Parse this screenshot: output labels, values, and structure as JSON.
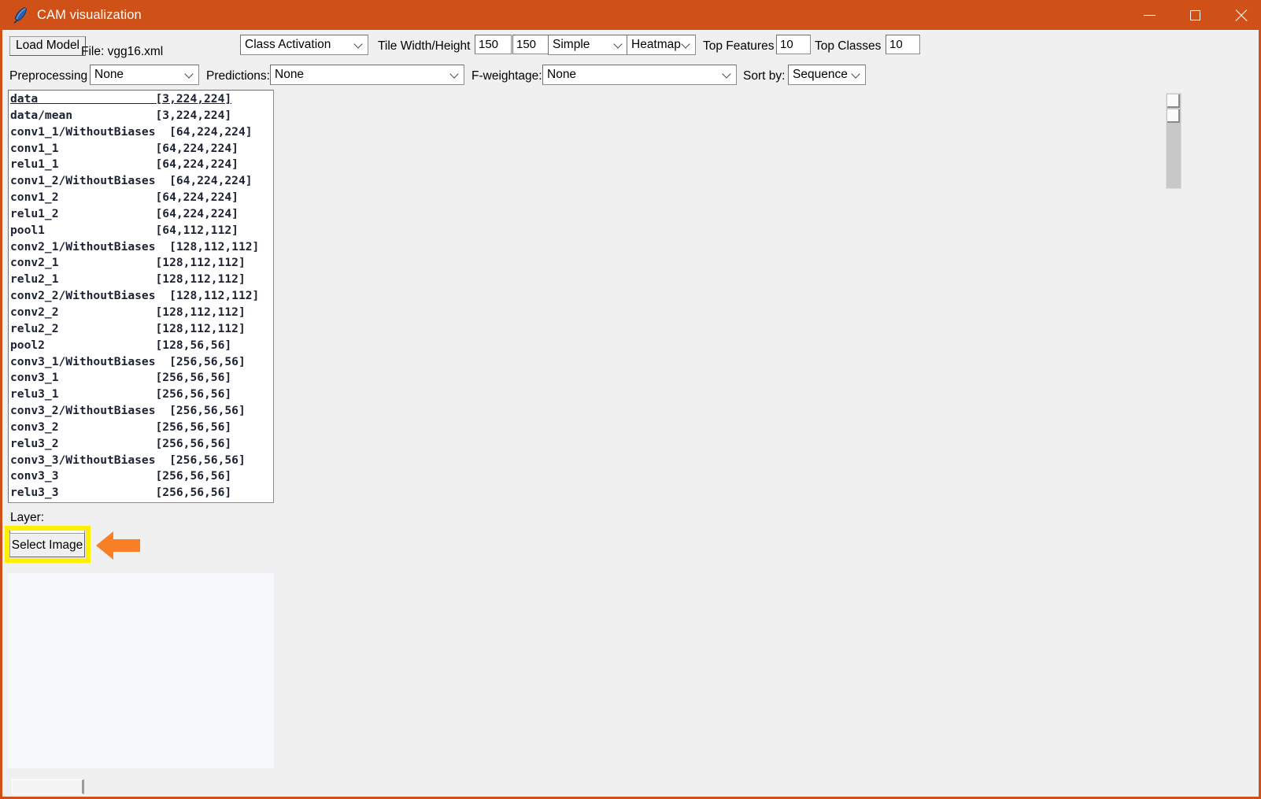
{
  "window": {
    "title": "CAM visualization",
    "icon": "feather-icon",
    "accent_color": "#cf5117",
    "controls": {
      "minimize": "minimize-icon",
      "maximize": "maximize-icon",
      "close": "close-icon"
    }
  },
  "toolbar": {
    "load_model_label": "Load Model",
    "file_label": "File: vgg16.xml",
    "mode_combo": "Class Activation",
    "tile_label": "Tile Width/Height",
    "tile_width": "150",
    "tile_height": "150",
    "simple_combo": "Simple",
    "heatmap_combo": "Heatmap",
    "top_features_label": "Top Features",
    "top_features_value": "10",
    "top_classes_label": "Top Classes",
    "top_classes_value": "10",
    "preprocessing_label": "Preprocessing",
    "preprocessing_combo": "None",
    "predictions_label": "Predictions:",
    "predictions_combo": "None",
    "fweightage_label": "F-weightage:",
    "fweightage_combo": "None",
    "sortby_label": "Sort by:",
    "sortby_combo": "Sequence"
  },
  "layer_list": {
    "rows": [
      {
        "name": "data",
        "shape": "[3,224,224]"
      },
      {
        "name": "data/mean",
        "shape": "[3,224,224]"
      },
      {
        "name": "conv1_1/WithoutBiases",
        "shape": "[64,224,224]"
      },
      {
        "name": "conv1_1",
        "shape": "[64,224,224]"
      },
      {
        "name": "relu1_1",
        "shape": "[64,224,224]"
      },
      {
        "name": "conv1_2/WithoutBiases",
        "shape": "[64,224,224]"
      },
      {
        "name": "conv1_2",
        "shape": "[64,224,224]"
      },
      {
        "name": "relu1_2",
        "shape": "[64,224,224]"
      },
      {
        "name": "pool1",
        "shape": "[64,112,112]"
      },
      {
        "name": "conv2_1/WithoutBiases",
        "shape": "[128,112,112]"
      },
      {
        "name": "conv2_1",
        "shape": "[128,112,112]"
      },
      {
        "name": "relu2_1",
        "shape": "[128,112,112]"
      },
      {
        "name": "conv2_2/WithoutBiases",
        "shape": "[128,112,112]"
      },
      {
        "name": "conv2_2",
        "shape": "[128,112,112]"
      },
      {
        "name": "relu2_2",
        "shape": "[128,112,112]"
      },
      {
        "name": "pool2",
        "shape": "[128,56,56]"
      },
      {
        "name": "conv3_1/WithoutBiases",
        "shape": "[256,56,56]"
      },
      {
        "name": "conv3_1",
        "shape": "[256,56,56]"
      },
      {
        "name": "relu3_1",
        "shape": "[256,56,56]"
      },
      {
        "name": "conv3_2/WithoutBiases",
        "shape": "[256,56,56]"
      },
      {
        "name": "conv3_2",
        "shape": "[256,56,56]"
      },
      {
        "name": "relu3_2",
        "shape": "[256,56,56]"
      },
      {
        "name": "conv3_3/WithoutBiases",
        "shape": "[256,56,56]"
      },
      {
        "name": "conv3_3",
        "shape": "[256,56,56]"
      },
      {
        "name": "relu3_3",
        "shape": "[256,56,56]"
      }
    ],
    "selected_index": 0
  },
  "bottom_panel": {
    "layer_caption": "Layer:",
    "layer_value": "",
    "select_image_label": "Select Image"
  },
  "annotation": {
    "highlight_color": "#ffef00",
    "arrow_color": "#f87f24",
    "arrow_direction": "left",
    "target": "Select Image"
  }
}
